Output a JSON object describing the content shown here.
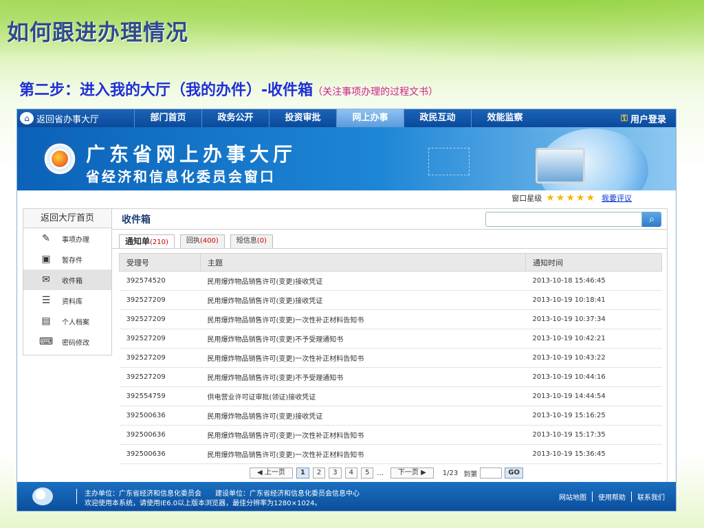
{
  "slide": {
    "title": "如何跟进办理情况",
    "step_main": "第二步：进入我的大厅（我的办件）-收件箱",
    "step_note": "（关注事项办理的过程文书）"
  },
  "topnav": {
    "home": "返回省办事大厅",
    "items": [
      "部门首页",
      "政务公开",
      "投资审批",
      "网上办事",
      "政民互动",
      "效能监察"
    ],
    "active_index": 3,
    "login": "用户登录"
  },
  "banner": {
    "title": "广东省网上办事大厅",
    "subtitle": "省经济和信息化委员会窗口"
  },
  "rating": {
    "label": "窗口星级",
    "stars": "★★★★★",
    "link": "我要评议"
  },
  "sidebar": {
    "header": "返回大厅首页",
    "items": [
      {
        "label": "事项办理",
        "icon": "edit-icon"
      },
      {
        "label": "暂存件",
        "icon": "save-icon"
      },
      {
        "label": "收件箱",
        "icon": "mail-icon"
      },
      {
        "label": "资料库",
        "icon": "database-icon"
      },
      {
        "label": "个人档案",
        "icon": "profile-icon"
      },
      {
        "label": "密码修改",
        "icon": "password-icon"
      }
    ],
    "active_index": 2
  },
  "inbox": {
    "title": "收件箱",
    "search_placeholder": "",
    "tabs": [
      {
        "label": "通知单",
        "count": "(210)"
      },
      {
        "label": "回执",
        "count": "(400)"
      },
      {
        "label": "短信息",
        "count": "(0)"
      }
    ],
    "columns": [
      "受理号",
      "主题",
      "通知时间"
    ],
    "rows": [
      [
        "392574520",
        "民用爆炸物品销售许可(变更)接收凭证",
        "2013-10-18 15:46:45"
      ],
      [
        "392527209",
        "民用爆炸物品销售许可(变更)接收凭证",
        "2013-10-19 10:18:41"
      ],
      [
        "392527209",
        "民用爆炸物品销售许可(变更)一次性补正材料告知书",
        "2013-10-19 10:37:34"
      ],
      [
        "392527209",
        "民用爆炸物品销售许可(变更)不予受理通知书",
        "2013-10-19 10:42:21"
      ],
      [
        "392527209",
        "民用爆炸物品销售许可(变更)一次性补正材料告知书",
        "2013-10-19 10:43:22"
      ],
      [
        "392527209",
        "民用爆炸物品销售许可(变更)不予受理通知书",
        "2013-10-19 10:44:16"
      ],
      [
        "392554759",
        "供电营业许可证审批(领证)接收凭证",
        "2013-10-19 14:44:54"
      ],
      [
        "392500636",
        "民用爆炸物品销售许可(变更)接收凭证",
        "2013-10-19 15:16:25"
      ],
      [
        "392500636",
        "民用爆炸物品销售许可(变更)一次性补正材料告知书",
        "2013-10-19 15:17:35"
      ],
      [
        "392500636",
        "民用爆炸物品销售许可(变更)一次性补正材料告知书",
        "2013-10-19 15:36:45"
      ]
    ]
  },
  "pager": {
    "prev": "◀ 上一页",
    "pages": [
      "1",
      "2",
      "3",
      "4",
      "5"
    ],
    "ellipsis": "...",
    "next": "下一页 ▶",
    "info": "1/23",
    "jump_label": "到第",
    "go": "GO"
  },
  "footer": {
    "line1": "主办单位：广东省经济和信息化委员会　　建设单位：广东省经济和信息化委员会信息中心",
    "line2": "欢迎使用本系统，请使用IE6.0以上版本浏览器，最佳分辨率为1280×1024。",
    "links": [
      "网站地图",
      "使用帮助",
      "联系我们"
    ]
  }
}
